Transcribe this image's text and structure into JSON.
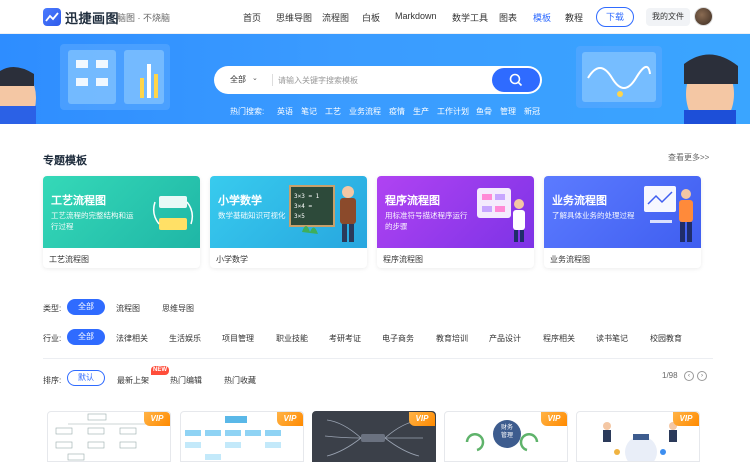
{
  "brand": {
    "name": "迅捷画图",
    "tagline": "脑图 · 不烧脑"
  },
  "nav": {
    "items": [
      {
        "label": "首页",
        "active": false
      },
      {
        "label": "思维导图",
        "active": false
      },
      {
        "label": "流程图",
        "active": false
      },
      {
        "label": "白板",
        "active": false
      },
      {
        "label": "Markdown",
        "active": false
      },
      {
        "label": "数学工具",
        "active": false
      },
      {
        "label": "图表",
        "active": false
      },
      {
        "label": "模板",
        "active": true
      },
      {
        "label": "教程",
        "active": false
      }
    ],
    "download_label": "下载",
    "my_files_label": "我的文件"
  },
  "search": {
    "category": "全部",
    "placeholder": "请输入关键字搜索模板",
    "hot_label": "热门搜索:",
    "hot_words": [
      "英语",
      "笔记",
      "工艺",
      "业务流程",
      "疫情",
      "生产",
      "工作计划",
      "鱼骨",
      "管理",
      "新冠"
    ]
  },
  "topics": {
    "title": "专题模板",
    "see_more": "查看更多>>",
    "cards": [
      {
        "title": "工艺流程图",
        "desc": "工艺流程的完整结构和运行过程",
        "caption": "工艺流程图",
        "color_from": "#2fd6b5",
        "color_to": "#1fb9a8"
      },
      {
        "title": "小学数学",
        "desc": "数学基础知识可视化",
        "caption": "小学数学",
        "color_from": "#34c4e8",
        "color_to": "#2aa8e0"
      },
      {
        "title": "程序流程图",
        "desc": "用标准符号描述程序运行的步骤",
        "caption": "程序流程图",
        "color_from": "#a93df0",
        "color_to": "#7f35e8"
      },
      {
        "title": "业务流程图",
        "desc": "了解具体业务的处理过程",
        "caption": "业务流程图",
        "color_from": "#5a78ff",
        "color_to": "#4260f0"
      }
    ]
  },
  "filters": {
    "type": {
      "label": "类型:",
      "options": [
        "全部",
        "流程图",
        "思维导图"
      ],
      "active": "全部"
    },
    "industry": {
      "label": "行业:",
      "options": [
        "全部",
        "法律相关",
        "生活娱乐",
        "项目管理",
        "职业技能",
        "考研考证",
        "电子商务",
        "教育培训",
        "产品设计",
        "程序相关",
        "读书笔记",
        "校园教育"
      ],
      "active": "全部"
    },
    "sort": {
      "label": "排序:",
      "options": [
        "默认",
        "最新上架",
        "热门编辑",
        "热门收藏"
      ],
      "active": "默认",
      "new_badge": "NEW"
    },
    "pager": "1/98"
  },
  "templates": [
    {
      "vip": "VIP",
      "style": "light"
    },
    {
      "vip": "VIP",
      "style": "light"
    },
    {
      "vip": "VIP",
      "style": "dark"
    },
    {
      "vip": "VIP",
      "style": "light",
      "center_text": "财务管理"
    },
    {
      "vip": "VIP",
      "style": "light"
    }
  ],
  "colors": {
    "accent": "#2f6bff",
    "banner": "#2e8dff",
    "vip": "#ff8a00",
    "new": "#ff4d3a"
  },
  "icons": [
    "logo-icon",
    "chevron-down-icon",
    "search-icon",
    "chevron-left-icon",
    "chevron-right-icon"
  ]
}
